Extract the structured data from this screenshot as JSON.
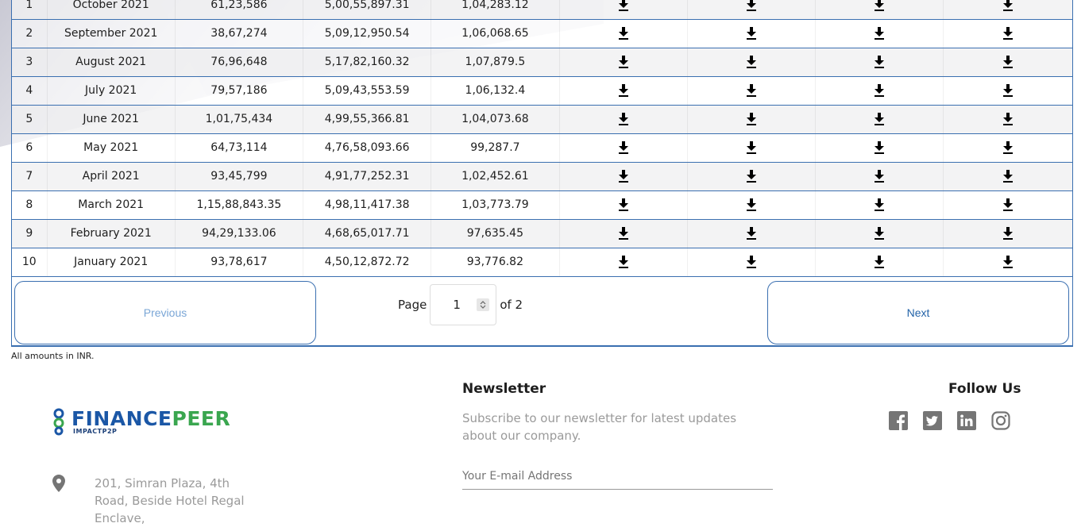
{
  "table": {
    "rows": [
      {
        "no": "1",
        "month": "October 2021",
        "v1": "61,23,586",
        "v2": "5,00,55,897.31",
        "v3": "1,04,283.12"
      },
      {
        "no": "2",
        "month": "September 2021",
        "v1": "38,67,274",
        "v2": "5,09,12,950.54",
        "v3": "1,06,068.65"
      },
      {
        "no": "3",
        "month": "August 2021",
        "v1": "76,96,648",
        "v2": "5,17,82,160.32",
        "v3": "1,07,879.5"
      },
      {
        "no": "4",
        "month": "July 2021",
        "v1": "79,57,186",
        "v2": "5,09,43,553.59",
        "v3": "1,06,132.4"
      },
      {
        "no": "5",
        "month": "June 2021",
        "v1": "1,01,75,434",
        "v2": "4,99,55,366.81",
        "v3": "1,04,073.68"
      },
      {
        "no": "6",
        "month": "May 2021",
        "v1": "64,73,114",
        "v2": "4,76,58,093.66",
        "v3": "99,287.7"
      },
      {
        "no": "7",
        "month": "April 2021",
        "v1": "93,45,799",
        "v2": "4,91,77,252.31",
        "v3": "1,02,452.61"
      },
      {
        "no": "8",
        "month": "March 2021",
        "v1": "1,15,88,843.35",
        "v2": "4,98,11,417.38",
        "v3": "1,03,773.79"
      },
      {
        "no": "9",
        "month": "February 2021",
        "v1": "94,29,133.06",
        "v2": "4,68,65,017.71",
        "v3": "97,635.45"
      },
      {
        "no": "10",
        "month": "January 2021",
        "v1": "93,78,617",
        "v2": "4,50,12,872.72",
        "v3": "93,776.82"
      }
    ],
    "download_icon": "download-icon"
  },
  "pagination": {
    "previous_label": "Previous",
    "next_label": "Next",
    "page_label": "Page",
    "current_page": "1",
    "of_label": "of 2"
  },
  "note": "All amounts in INR.",
  "footer": {
    "logo_part1": "FINANCE",
    "logo_part2": "PEER",
    "logo_sub": "IMPACTP2P",
    "newsletter_title": "Newsletter",
    "newsletter_desc": "Subscribe to our newsletter for latest updates about our company.",
    "email_placeholder": "Your E-mail Address",
    "follow_title": "Follow Us",
    "address": "201, Simran Plaza, 4th Road, Beside Hotel Regal Enclave,",
    "social_icons": [
      "facebook-icon",
      "twitter-icon",
      "linkedin-icon",
      "instagram-icon"
    ]
  },
  "colors": {
    "accent": "#3a6fb0",
    "logo_blue": "#1b57a6",
    "logo_green": "#3aa64f",
    "muted_text": "#9a9a9a"
  }
}
